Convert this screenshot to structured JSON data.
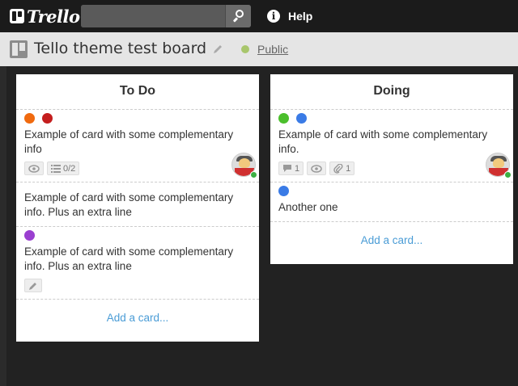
{
  "app": {
    "name": "Trello"
  },
  "header": {
    "search": {
      "value": "",
      "placeholder": ""
    },
    "help_label": "Help"
  },
  "board": {
    "title": "Tello theme test board",
    "visibility": "Public",
    "visibility_color": "#a8c66c"
  },
  "lists": [
    {
      "title": "To Do",
      "add_card": "Add a card...",
      "cards": [
        {
          "labels": [
            "#f06a0f",
            "#c41e1e"
          ],
          "text": "Example of card with some complementary info",
          "badges": {
            "checklist": "0/2"
          },
          "icons": [
            "eye-icon",
            "checklist-icon"
          ],
          "has_avatar": true
        },
        {
          "labels": [],
          "text": "Example of card with some complementary info. Plus an extra line"
        },
        {
          "labels": [
            "#9a3fd0"
          ],
          "text": "Example of card with some complementary info. Plus an extra line",
          "icons": [
            "pencil-icon"
          ]
        }
      ]
    },
    {
      "title": "Doing",
      "add_card": "Add a card...",
      "cards": [
        {
          "labels": [
            "#4bbf2c",
            "#3a7be6"
          ],
          "text": "Example of card with some complementary info.",
          "badges": {
            "comments": "1",
            "attachments": "1"
          },
          "icons": [
            "comment-icon",
            "eye-icon",
            "paperclip-icon"
          ],
          "has_avatar": true
        },
        {
          "labels": [
            "#3a7be6"
          ],
          "text": "Another one"
        }
      ]
    }
  ]
}
